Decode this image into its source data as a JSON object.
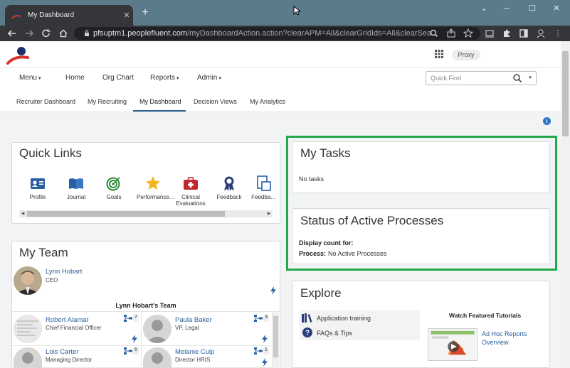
{
  "browser": {
    "tab_title": "My Dashboard",
    "tab_close": "✕",
    "new_tab": "+",
    "url_host": "pfsuptm1.peoplefluent.com",
    "url_path": "/myDashboardAction.action?clearAPM=All&clearGridIds=All&clearSea...",
    "window_controls": {
      "minimize": "─",
      "restore": "☐",
      "close": "✕",
      "collapse": "⌄"
    }
  },
  "header": {
    "proxy_label": "Proxy"
  },
  "mainnav": {
    "items": [
      {
        "label": "Menu",
        "caret": "▾"
      },
      {
        "label": "Home",
        "caret": ""
      },
      {
        "label": "Org Chart",
        "caret": ""
      },
      {
        "label": "Reports",
        "caret": "▾"
      },
      {
        "label": "Admin",
        "caret": "▾"
      }
    ],
    "quickfind_placeholder": "Quick Find",
    "quickfind_caret": "▾"
  },
  "subnav": {
    "items": [
      "Recruiter Dashboard",
      "My Recruiting",
      "My Dashboard",
      "Decision Views",
      "My Analytics"
    ],
    "active_index": 2
  },
  "quick_links": {
    "title": "Quick Links",
    "items": [
      {
        "label": "Profile",
        "icon": "profile-card-icon"
      },
      {
        "label": "Journal",
        "icon": "book-icon"
      },
      {
        "label": "Goals",
        "icon": "target-icon"
      },
      {
        "label": "Performance...",
        "icon": "star-icon"
      },
      {
        "label": "Clinical Evaluations",
        "icon": "first-aid-kit-icon"
      },
      {
        "label": "Feedback",
        "icon": "award-ribbon-icon"
      },
      {
        "label": "Feedba...",
        "icon": "feedback-doc-icon"
      }
    ],
    "scroll_left": "◀",
    "scroll_right": "▶"
  },
  "my_team": {
    "title": "My Team",
    "manager": {
      "name": "Lynn Hobart",
      "title": "CEO"
    },
    "team_label": "Lynn Hobart's Team",
    "members": [
      {
        "name": "Robert Alamar",
        "title": "Chief Financial Officer",
        "count": "7"
      },
      {
        "name": "Paula Baker",
        "title": "VP, Legal",
        "count": "3"
      },
      {
        "name": "Lois Carter",
        "title": "Managing Director",
        "count": "6"
      },
      {
        "name": "Melanie Culp",
        "title": "Director HRIS",
        "count": "1"
      }
    ]
  },
  "my_tasks": {
    "title": "My Tasks",
    "empty_text": "No tasks"
  },
  "processes": {
    "title": "Status of Active Processes",
    "display_label": "Display count for:",
    "process_label": "Process:",
    "process_value": "No Active Processes"
  },
  "explore": {
    "title": "Explore",
    "items": [
      {
        "label": "Application training",
        "icon": "books-icon"
      },
      {
        "label": "FAQs & Tips",
        "icon": "help-circle-icon"
      }
    ],
    "tutorials_heading": "Watch Featured Tutorials",
    "tutorial_link": "Ad Hoc Reports Overview"
  },
  "colors": {
    "accent_blue": "#2a5f9e",
    "highlight_green": "#22a94a",
    "chrome_dark": "#35363a"
  }
}
